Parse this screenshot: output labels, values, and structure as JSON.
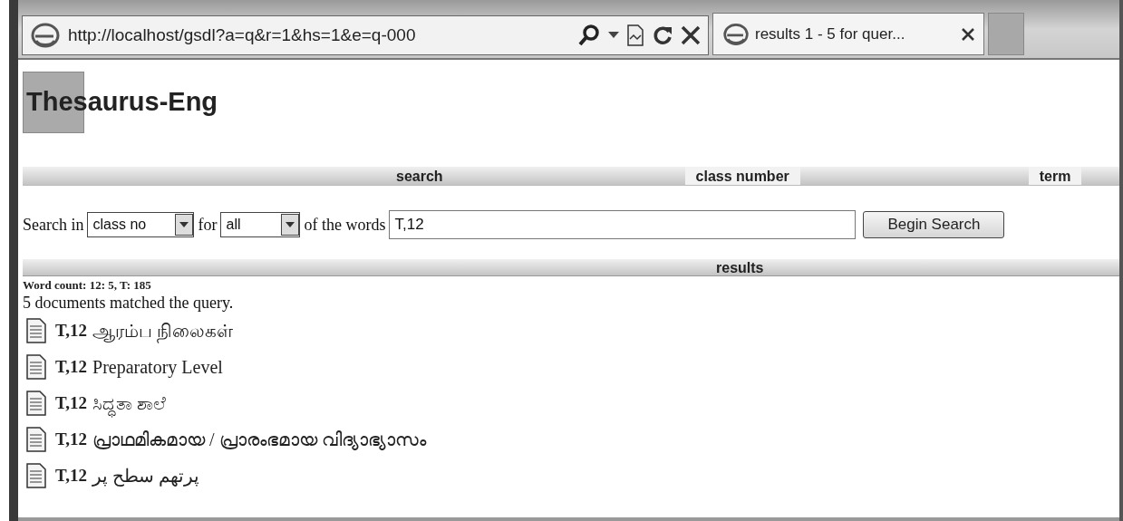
{
  "browser": {
    "address": "http://localhost/gsdl?a=q&r=1&hs=1&e=q-000",
    "tab": {
      "title": "results 1 - 5 for quer...",
      "selected": true
    }
  },
  "collection_title": "Thesaurus-Eng",
  "nav_bar": [
    {
      "label": "search",
      "selected": false
    },
    {
      "label": "class number",
      "selected": true
    },
    {
      "label": "term",
      "selected": true
    }
  ],
  "search_form": {
    "prefix": "Search in",
    "field_select": "class no",
    "connector": "for",
    "mode_select": "all",
    "suffix": "of the words",
    "query": "T,12",
    "button": "Begin Search"
  },
  "results_heading": "results",
  "word_count": "Word count: 12: 5, T: 185",
  "match_message": "5 documents matched the query.",
  "documents": [
    {
      "class_no": "T,12",
      "title": "ஆரம்ப நிலைகள்"
    },
    {
      "class_no": "T,12",
      "title": "Preparatory Level"
    },
    {
      "class_no": "T,12",
      "title": "ಸಿದ್ಧತಾ ಶಾಲೆ"
    },
    {
      "class_no": "T,12",
      "title": "പ്രാഥമികമായ / പ്രാരംഭമായ വിദ്യാഭ്യാസം"
    },
    {
      "class_no": "T,12",
      "title": "پرتھم سطح پر"
    }
  ]
}
